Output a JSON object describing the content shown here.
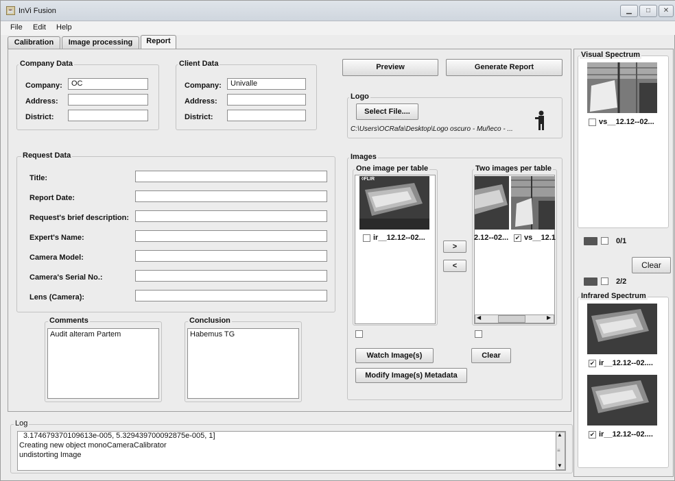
{
  "window": {
    "title": "InVi Fusion",
    "app_icon": "java-cup-icon"
  },
  "menu": [
    "File",
    "Edit",
    "Help"
  ],
  "tabs": [
    "Calibration",
    "Image processing",
    "Report"
  ],
  "active_tab": "Report",
  "company_data": {
    "title": "Company Data",
    "company_label": "Company:",
    "company_value": "OC",
    "address_label": "Address:",
    "address_value": "",
    "district_label": "District:",
    "district_value": ""
  },
  "client_data": {
    "title": "Client Data",
    "company_label": "Company:",
    "company_value": "Univalle",
    "address_label": "Address:",
    "address_value": "",
    "district_label": "District:",
    "district_value": ""
  },
  "actions": {
    "preview": "Preview",
    "generate": "Generate Report"
  },
  "logo": {
    "title": "Logo",
    "select_button": "Select File....",
    "path": "C:\\Users\\OCRafa\\Desktop\\Logo oscuro - Muñeco - ..."
  },
  "request_data": {
    "title": "Request Data",
    "fields": [
      {
        "label": "Title:",
        "value": ""
      },
      {
        "label": "Report Date:",
        "value": ""
      },
      {
        "label": "Request's brief description:",
        "value": ""
      },
      {
        "label": "Expert's Name:",
        "value": ""
      },
      {
        "label": "Camera Model:",
        "value": ""
      },
      {
        "label": "Camera's Serial No.:",
        "value": ""
      },
      {
        "label": "Lens (Camera):",
        "value": ""
      }
    ]
  },
  "comments": {
    "title": "Comments",
    "value": "Audit alteram Partem"
  },
  "conclusion": {
    "title": "Conclusion",
    "value": "Habemus TG"
  },
  "images": {
    "title": "Images",
    "one_per_table": {
      "title": "One image per table",
      "item_label": "ir__12.12--02..."
    },
    "two_per_table": {
      "title": "Two images per table",
      "item1_label": "2.12--02...",
      "item2_label": "vs__12.1"
    },
    "move_right": ">",
    "move_left": "<",
    "watch_button": "Watch Image(s)",
    "clear_button": "Clear",
    "modify_button": "Modify Image(s) Metadata",
    "flir_mark": "◊FLIR"
  },
  "visual_spectrum": {
    "title": "Visual Spectrum",
    "item_label": "vs__12.12--02...",
    "counter": "0/1"
  },
  "right_clear": "Clear",
  "infrared_counter": "2/2",
  "infrared_spectrum": {
    "title": "Infrared Spectrum",
    "items": [
      "ir__12.12--02....",
      "ir__12.12--02...."
    ]
  },
  "log": {
    "title": "Log",
    "lines": [
      "3.174679370109613e-005, 5.329439700092875e-005, 1]",
      "Creating new object monoCameraCalibrator",
      "undistorting Image"
    ]
  }
}
